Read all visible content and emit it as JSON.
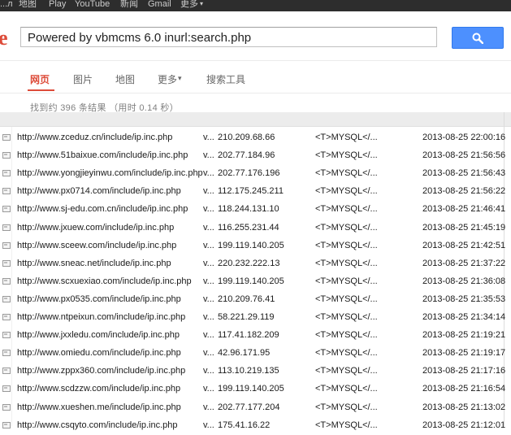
{
  "topbar": {
    "items": [
      "...л",
      "地图",
      "Play",
      "YouTube",
      "新闻",
      "Gmail",
      "更多"
    ],
    "more_caret": "▾"
  },
  "search": {
    "logo_fragment": "e",
    "query": "Powered by vbmcms 6.0 inurl:search.php",
    "button_icon": "search-icon",
    "button_color": "#4d90fe"
  },
  "nav": {
    "tabs": [
      "网页",
      "图片",
      "地图",
      "更多",
      "搜索工具"
    ],
    "more_caret": "▾",
    "active_color": "#dd4b39"
  },
  "stats": "找到约 396 条结果 （用时 0.14 秒）",
  "results": [
    {
      "url": "http://www.zceduz.cn/include/ip.inc.php",
      "v": "v...",
      "ip": "210.209.68.66",
      "tag": "<T>MYSQL</...",
      "date": "2013-08-25 22:00:16"
    },
    {
      "url": "http://www.51baixue.com/include/ip.inc.php",
      "v": "v...",
      "ip": "202.77.184.96",
      "tag": "<T>MYSQL</...",
      "date": "2013-08-25 21:56:56"
    },
    {
      "url": "http://www.yongjieyinwu.com/include/ip.inc.php",
      "v": "v...",
      "ip": "202.77.176.196",
      "tag": "<T>MYSQL</...",
      "date": "2013-08-25 21:56:43"
    },
    {
      "url": "http://www.px0714.com/include/ip.inc.php",
      "v": "v...",
      "ip": "112.175.245.211",
      "tag": "<T>MYSQL</...",
      "date": "2013-08-25 21:56:22"
    },
    {
      "url": "http://www.sj-edu.com.cn/include/ip.inc.php",
      "v": "v...",
      "ip": "118.244.131.10",
      "tag": "<T>MYSQL</...",
      "date": "2013-08-25 21:46:41"
    },
    {
      "url": "http://www.jxuew.com/include/ip.inc.php",
      "v": "v...",
      "ip": "116.255.231.44",
      "tag": "<T>MYSQL</...",
      "date": "2013-08-25 21:45:19"
    },
    {
      "url": "http://www.sceew.com/include/ip.inc.php",
      "v": "v...",
      "ip": "199.119.140.205",
      "tag": "<T>MYSQL</...",
      "date": "2013-08-25 21:42:51"
    },
    {
      "url": "http://www.sneac.net/include/ip.inc.php",
      "v": "v...",
      "ip": "220.232.222.13",
      "tag": "<T>MYSQL</...",
      "date": "2013-08-25 21:37:22"
    },
    {
      "url": "http://www.scxuexiao.com/include/ip.inc.php",
      "v": "v...",
      "ip": "199.119.140.205",
      "tag": "<T>MYSQL</...",
      "date": "2013-08-25 21:36:08"
    },
    {
      "url": "http://www.px0535.com/include/ip.inc.php",
      "v": "v...",
      "ip": "210.209.76.41",
      "tag": "<T>MYSQL</...",
      "date": "2013-08-25 21:35:53"
    },
    {
      "url": "http://www.ntpeixun.com/include/ip.inc.php",
      "v": "v...",
      "ip": "58.221.29.119",
      "tag": "<T>MYSQL</...",
      "date": "2013-08-25 21:34:14"
    },
    {
      "url": "http://www.jxxledu.com/include/ip.inc.php",
      "v": "v...",
      "ip": "117.41.182.209",
      "tag": "<T>MYSQL</...",
      "date": "2013-08-25 21:19:21"
    },
    {
      "url": "http://www.omiedu.com/include/ip.inc.php",
      "v": "v...",
      "ip": "42.96.171.95",
      "tag": "<T>MYSQL</...",
      "date": "2013-08-25 21:19:17"
    },
    {
      "url": "http://www.zppx360.com/include/ip.inc.php",
      "v": "v...",
      "ip": "113.10.219.135",
      "tag": "<T>MYSQL</...",
      "date": "2013-08-25 21:17:16"
    },
    {
      "url": "http://www.scdzzw.com/include/ip.inc.php",
      "v": "v...",
      "ip": "199.119.140.205",
      "tag": "<T>MYSQL</...",
      "date": "2013-08-25 21:16:54"
    },
    {
      "url": "http://www.xueshen.me/include/ip.inc.php",
      "v": "v...",
      "ip": "202.77.177.204",
      "tag": "<T>MYSQL</...",
      "date": "2013-08-25 21:13:02"
    },
    {
      "url": "http://www.csqyto.com/include/ip.inc.php",
      "v": "v...",
      "ip": "175.41.16.22",
      "tag": "<T>MYSQL</...",
      "date": "2013-08-25 21:12:01"
    }
  ]
}
